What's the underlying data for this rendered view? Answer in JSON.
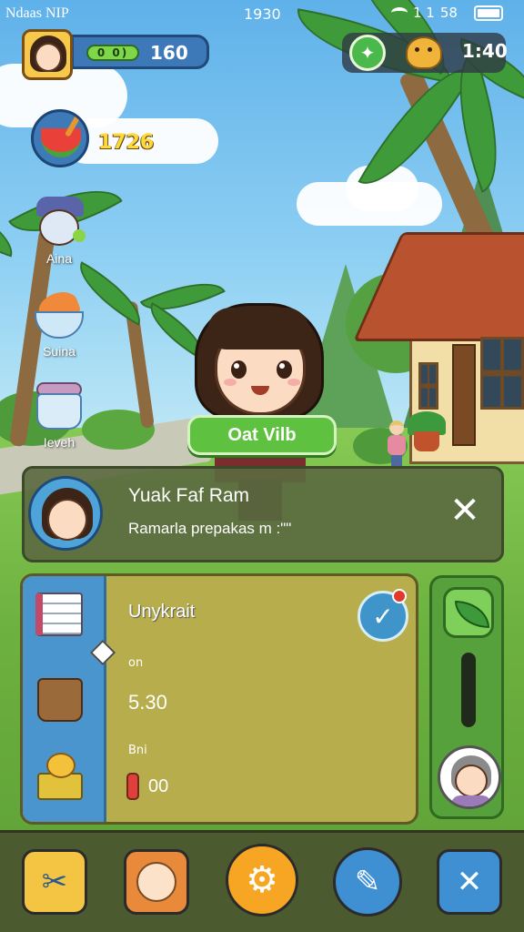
{
  "status_bar": {
    "carrier": "Ndaas NIP",
    "time": "1930",
    "signal": "1 1",
    "battery_pct": "58"
  },
  "hud": {
    "bar_label": "0 0)",
    "bar_value": "160",
    "clock": "1:40",
    "gold": "1726"
  },
  "sidebar": {
    "items": [
      {
        "label": "Aina",
        "icon": "villager-portrait-icon"
      },
      {
        "label": "Suina",
        "icon": "food-bowl-icon"
      },
      {
        "label": "Ieveh",
        "icon": "jar-icon"
      }
    ]
  },
  "cta": {
    "label": "Oat Vilb"
  },
  "notification": {
    "title": "Yuak Faf Ram",
    "body": "Ramarla prepakas m :\"\""
  },
  "panel": {
    "title": "Unykrait",
    "label_1": "on",
    "value_1": "5.30",
    "label_2": "Bni",
    "value_2": "00",
    "tabs": [
      {
        "icon": "notebook-icon"
      },
      {
        "icon": "bag-icon"
      },
      {
        "icon": "chick-crate-icon"
      }
    ]
  },
  "bottom_bar": {
    "buttons": [
      {
        "icon": "tools-icon",
        "color": "#f4c542"
      },
      {
        "icon": "chef-icon",
        "color": "#e98a3a"
      },
      {
        "icon": "settings-gear-icon",
        "color": "#f6a623"
      },
      {
        "icon": "wrench-icon",
        "color": "#3f8fd3"
      },
      {
        "icon": "close-icon",
        "color": "#3f8fd3"
      }
    ]
  },
  "colors": {
    "sky": "#5fb1ea",
    "grass": "#6db140",
    "accent_green": "#5fc140",
    "hud_blue": "#3d78b9",
    "panel_olive": "#b7ad4c"
  }
}
